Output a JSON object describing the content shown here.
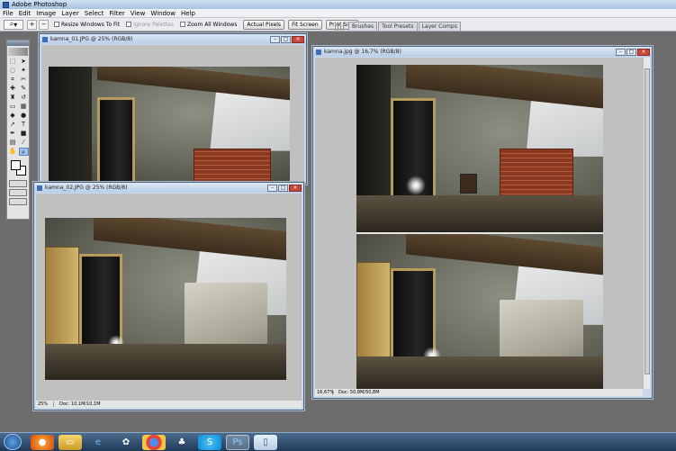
{
  "app": {
    "title": "Adobe Photoshop"
  },
  "menu": [
    "File",
    "Edit",
    "Image",
    "Layer",
    "Select",
    "Filter",
    "View",
    "Window",
    "Help"
  ],
  "options": {
    "zoom_tool": "zoom-in",
    "checkboxes": [
      {
        "label": "Resize Windows To Fit",
        "checked": false,
        "enabled": true
      },
      {
        "label": "Ignore Palettes",
        "checked": false,
        "enabled": false
      },
      {
        "label": "Zoom All Windows",
        "checked": false,
        "enabled": true
      }
    ],
    "buttons": [
      "Actual Pixels",
      "Fit Screen",
      "Print Size"
    ]
  },
  "palette_well": [
    "Brushes",
    "Tool Presets",
    "Layer Comps"
  ],
  "windows": {
    "doc1": {
      "title": "kamna_01.JPG @ 25% (RGB/8)"
    },
    "doc2": {
      "title": "kamna_02.JPG @ 25% (RGB/8)",
      "zoom": "25%",
      "doc": "Doc: 10,1M/10,1M"
    },
    "doc3": {
      "title": "kamna.jpg @ 16,7% (RGB/8)",
      "zoom": "16,67%",
      "doc": "Doc: 50,8M/50,8M"
    }
  },
  "taskbar": [
    "firefox",
    "windows-explorer",
    "internet-explorer",
    "gimp",
    "chrome",
    "games",
    "skype",
    "photoshop",
    "app"
  ]
}
